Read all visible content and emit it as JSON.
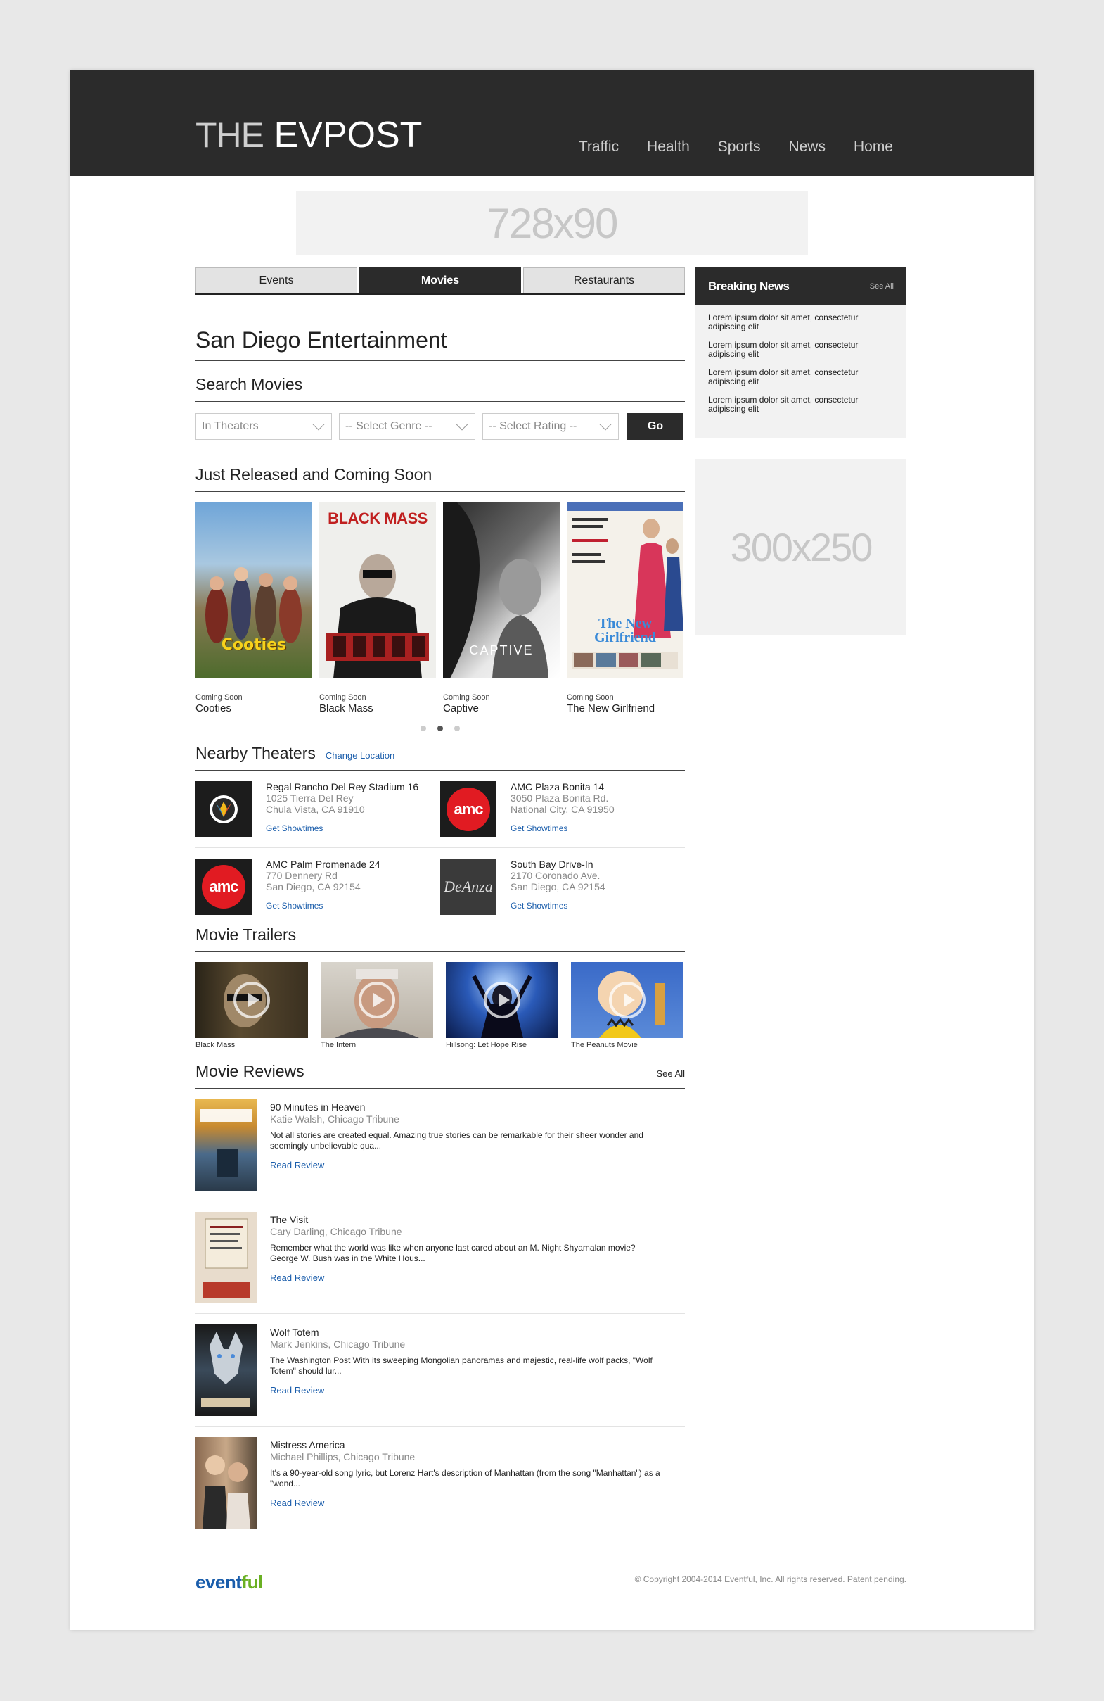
{
  "header": {
    "logo_thin": "THE",
    "logo_bold": "EVPOST",
    "nav": [
      "Traffic",
      "Health",
      "Sports",
      "News",
      "Home"
    ]
  },
  "ads": {
    "top": "728x90",
    "side": "300x250"
  },
  "tabs": [
    "Events",
    "Movies",
    "Restaurants"
  ],
  "active_tab": "Movies",
  "page_title": "San Diego Entertainment",
  "search": {
    "title": "Search Movies",
    "filters": [
      "In Theaters",
      "-- Select Genre --",
      "-- Select Rating --"
    ],
    "go_label": "Go"
  },
  "just_released": {
    "title": "Just Released and Coming Soon",
    "posters": [
      {
        "status": "Coming Soon",
        "title": "Cooties",
        "poster_text": "Cooties"
      },
      {
        "status": "Coming Soon",
        "title": "Black Mass",
        "poster_text": "BLACK MASS"
      },
      {
        "status": "Coming Soon",
        "title": "Captive",
        "poster_text": "CAPTIVE"
      },
      {
        "status": "Coming Soon",
        "title": "The New Girlfriend",
        "poster_text": "The New Girlfriend"
      }
    ]
  },
  "nearby": {
    "title": "Nearby Theaters",
    "change_location": "Change Location",
    "theaters": [
      {
        "name": "Regal Rancho Del Rey Stadium 16",
        "address": "1025 Tierra Del Rey",
        "city": "Chula Vista, CA 91910",
        "link": "Get Showtimes",
        "logo": "regal"
      },
      {
        "name": "AMC Plaza Bonita 14",
        "address": "3050 Plaza Bonita Rd.",
        "city": "National City, CA 91950",
        "link": "Get Showtimes",
        "logo": "amc"
      },
      {
        "name": "AMC Palm Promenade 24",
        "address": "770 Dennery Rd",
        "city": "San Diego, CA 92154",
        "link": "Get Showtimes",
        "logo": "amc"
      },
      {
        "name": "South Bay Drive-In",
        "address": "2170 Coronado Ave.",
        "city": "San Diego, CA 92154",
        "link": "Get Showtimes",
        "logo": "deanza"
      }
    ],
    "logo_text_amc": "amc",
    "logo_text_deanza": "DeAnza"
  },
  "trailers": {
    "title": "Movie Trailers",
    "items": [
      "Black Mass",
      "The Intern",
      "Hillsong: Let Hope Rise",
      "The Peanuts Movie"
    ]
  },
  "reviews": {
    "title": "Movie Reviews",
    "see_all": "See All",
    "items": [
      {
        "title": "90 Minutes in Heaven",
        "author": "Katie Walsh, Chicago Tribune",
        "text": "Not all stories are created equal. Amazing true stories can be remarkable for their sheer wonder and seemingly unbelievable qua...",
        "link": "Read Review"
      },
      {
        "title": "The Visit",
        "author": "Cary Darling, Chicago Tribune",
        "text": "Remember what the world was like when anyone last cared about an M. Night Shyamalan movie? George W. Bush was in the White Hous...",
        "link": "Read Review"
      },
      {
        "title": "Wolf Totem",
        "author": "Mark Jenkins, Chicago Tribune",
        "text": "The Washington Post With its sweeping Mongolian panoramas and majestic, real-life wolf packs, \"Wolf Totem\" should lur...",
        "link": "Read Review"
      },
      {
        "title": "Mistress America",
        "author": "Michael Phillips, Chicago Tribune",
        "text": "It's a 90-year-old song lyric, but Lorenz Hart's description of Manhattan (from the song \"Manhattan\") as a \"wond...",
        "link": "Read Review"
      }
    ]
  },
  "breaking_news": {
    "title": "Breaking News",
    "see_all": "See All",
    "items": [
      "Lorem ipsum dolor sit amet, consectetur adipiscing elit",
      "Lorem ipsum dolor sit amet, consectetur adipiscing elit",
      "Lorem ipsum dolor sit amet, consectetur adipiscing elit",
      "Lorem ipsum dolor sit amet, consectetur adipiscing elit"
    ]
  },
  "footer": {
    "logo_a": "event",
    "logo_b": "ful",
    "copyright": "© Copyright 2004-2014 Eventful, Inc. All rights reserved. Patent pending."
  },
  "colors": {
    "header_bg": "#2b2b2b",
    "link": "#1a5dab",
    "footer_logo_green": "#6ab023"
  }
}
